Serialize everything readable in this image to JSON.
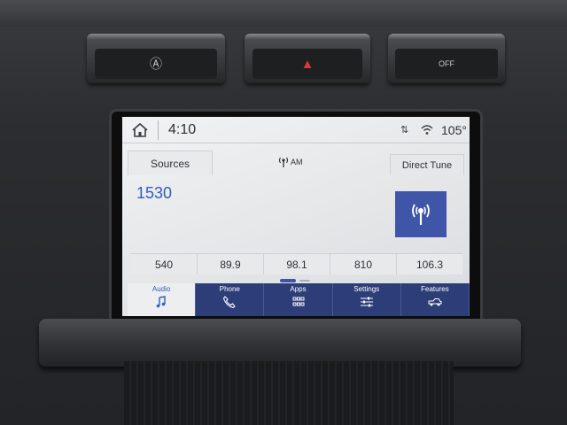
{
  "hardware": {
    "buttons": [
      {
        "name": "auto-start-stop",
        "glyph": "Ⓐ"
      },
      {
        "name": "hazard",
        "glyph": "▲"
      },
      {
        "name": "traction-off",
        "glyph": "OFF"
      }
    ]
  },
  "status": {
    "time": "4:10",
    "signal_glyph": "⇅",
    "temperature": "105°"
  },
  "audio": {
    "sources_label": "Sources",
    "band_label": "AM",
    "direct_tune_label": "Direct Tune",
    "frequency": "1530",
    "presets": [
      "540",
      "89.9",
      "98.1",
      "810",
      "106.3"
    ]
  },
  "nav": {
    "items": [
      {
        "label": "Audio",
        "icon": "music-note-icon"
      },
      {
        "label": "Phone",
        "icon": "phone-icon"
      },
      {
        "label": "Apps",
        "icon": "apps-grid-icon"
      },
      {
        "label": "Settings",
        "icon": "sliders-icon"
      },
      {
        "label": "Features",
        "icon": "truck-icon"
      }
    ]
  },
  "colors": {
    "accent_blue": "#2f5fb8",
    "nav_bar": "#2c3d78",
    "hazard_red": "#d33a3a"
  }
}
